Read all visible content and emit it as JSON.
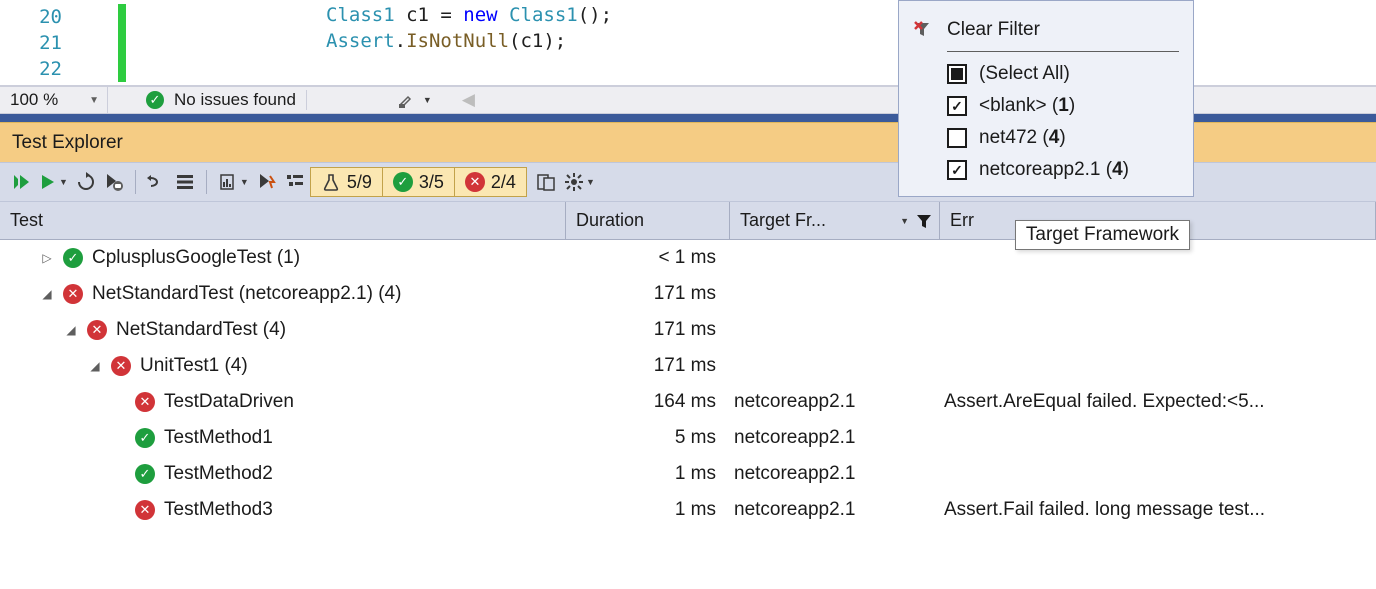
{
  "editor": {
    "lines": [
      {
        "num": "20",
        "tokens": [
          [
            "type",
            "Class1"
          ],
          [
            "pun",
            " c1 = "
          ],
          [
            "kw",
            "new"
          ],
          [
            "pun",
            " "
          ],
          [
            "type",
            "Class1"
          ],
          [
            "pun",
            "();"
          ]
        ]
      },
      {
        "num": "21",
        "tokens": [
          [
            "type",
            "Assert"
          ],
          [
            "pun",
            "."
          ],
          [
            "fun",
            "IsNotNull"
          ],
          [
            "pun",
            "(c1);"
          ]
        ]
      },
      {
        "num": "22",
        "tokens": []
      }
    ]
  },
  "status": {
    "zoom": "100 %",
    "issues": "No issues found"
  },
  "panel": {
    "title": "Test Explorer"
  },
  "counts": {
    "total": "5/9",
    "pass": "3/5",
    "fail": "2/4"
  },
  "columns": {
    "test": "Test",
    "duration": "Duration",
    "targetfw": "Target Fr...",
    "error": "Err"
  },
  "rows": [
    {
      "depth": 0,
      "twist": "▷",
      "outcome": "pass",
      "name": "CplusplusGoogleTest  (1)",
      "dur": "< 1 ms",
      "tfw": "",
      "err": ""
    },
    {
      "depth": 0,
      "twist": "◢",
      "outcome": "fail",
      "name": "NetStandardTest (netcoreapp2.1)  (4)",
      "dur": "171 ms",
      "tfw": "",
      "err": ""
    },
    {
      "depth": 1,
      "twist": "◢",
      "outcome": "fail",
      "name": "NetStandardTest  (4)",
      "dur": "171 ms",
      "tfw": "",
      "err": ""
    },
    {
      "depth": 2,
      "twist": "◢",
      "outcome": "fail",
      "name": "UnitTest1  (4)",
      "dur": "171 ms",
      "tfw": "",
      "err": ""
    },
    {
      "depth": 3,
      "twist": "",
      "outcome": "fail",
      "name": "TestDataDriven",
      "dur": "164 ms",
      "tfw": "netcoreapp2.1",
      "err": "Assert.AreEqual failed. Expected:<5..."
    },
    {
      "depth": 3,
      "twist": "",
      "outcome": "pass",
      "name": "TestMethod1",
      "dur": "5 ms",
      "tfw": "netcoreapp2.1",
      "err": ""
    },
    {
      "depth": 3,
      "twist": "",
      "outcome": "pass",
      "name": "TestMethod2",
      "dur": "1 ms",
      "tfw": "netcoreapp2.1",
      "err": ""
    },
    {
      "depth": 3,
      "twist": "",
      "outcome": "fail",
      "name": "TestMethod3",
      "dur": "1 ms",
      "tfw": "netcoreapp2.1",
      "err": "Assert.Fail failed. long message test..."
    }
  ],
  "filter": {
    "clear": "Clear Filter",
    "tooltip": "Target Framework",
    "options": [
      {
        "state": "square",
        "label": "(Select All)",
        "count": ""
      },
      {
        "state": "check",
        "label": "<blank>",
        "count": "1"
      },
      {
        "state": "none",
        "label": "net472",
        "count": "4"
      },
      {
        "state": "check",
        "label": "netcoreapp2.1",
        "count": "4"
      }
    ]
  }
}
